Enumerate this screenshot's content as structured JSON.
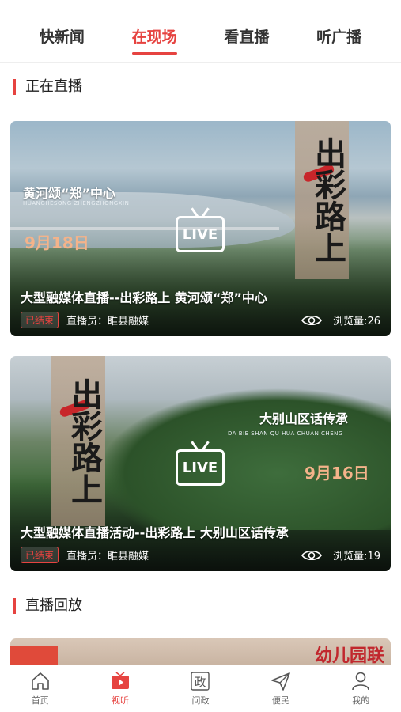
{
  "top_tabs": [
    {
      "label": "快新闻",
      "active": false
    },
    {
      "label": "在现场",
      "active": true
    },
    {
      "label": "看直播",
      "active": false
    },
    {
      "label": "听广播",
      "active": false
    }
  ],
  "sections": {
    "live_now": "正在直播",
    "replay": "直播回放"
  },
  "cards": [
    {
      "title": "大型融媒体直播--出彩路上 黄河颂“郑”中心",
      "status": "已结束",
      "host_label": "直播员：睢县融媒",
      "views": "浏览量:26",
      "overlay_title": "黄河颂“郑”中心",
      "overlay_sub": "HUANGHESONG ZHENGZHONGXIN",
      "overlay_date": "9月18日",
      "live_text": "LIVE",
      "poster_text": "出彩路上"
    },
    {
      "title": "大型融媒体直播活动--出彩路上 大别山区话传承",
      "status": "已结束",
      "host_label": "直播员：睢县融媒",
      "views": "浏览量:19",
      "overlay_title": "大别山区话传承",
      "overlay_sub": "DA BIE SHAN QU HUA CHUAN CHENG",
      "overlay_date": "9月16日",
      "live_text": "LIVE",
      "poster_text": "出彩路上"
    }
  ],
  "replay_preview_text": "幼儿园联",
  "bottom_nav": [
    {
      "label": "首页",
      "icon": "home-icon",
      "active": false
    },
    {
      "label": "视听",
      "icon": "video-icon",
      "active": true
    },
    {
      "label": "问政",
      "icon": "zheng-icon",
      "active": false
    },
    {
      "label": "便民",
      "icon": "send-icon",
      "active": false
    },
    {
      "label": "我的",
      "icon": "user-icon",
      "active": false
    }
  ],
  "colors": {
    "accent": "#e64340"
  }
}
